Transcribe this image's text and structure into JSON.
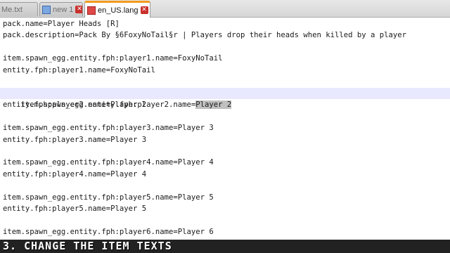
{
  "tabs": [
    {
      "label": "Me.txt",
      "active": false,
      "unsaved": false
    },
    {
      "label": "new 1",
      "active": false,
      "unsaved": false
    },
    {
      "label": "en_US.lang",
      "active": true,
      "unsaved": true
    }
  ],
  "editor": {
    "lines": [
      "pack.name=Player Heads [R]",
      "pack.description=Pack By §6FoxyNoTail§r | Players drop their heads when killed by a player",
      "",
      "item.spawn_egg.entity.fph:player1.name=FoxyNoTail",
      "entity.fph:player1.name=FoxyNoTail",
      "",
      "",
      "item.spawn_egg.entity.fph:player2.name=Player 2",
      "entity.fph:player2.name=Player 2",
      "",
      "item.spawn_egg.entity.fph:player3.name=Player 3",
      "entity.fph:player3.name=Player 3",
      "",
      "item.spawn_egg.entity.fph:player4.name=Player 4",
      "entity.fph:player4.name=Player 4",
      "",
      "item.spawn_egg.entity.fph:player5.name=Player 5",
      "entity.fph:player5.name=Player 5",
      "",
      "item.spawn_egg.entity.fph:player6.name=Player 6"
    ],
    "current_line": 7,
    "selected_text": "Player 2"
  },
  "caption": "3. CHANGE THE ITEM TEXTS"
}
